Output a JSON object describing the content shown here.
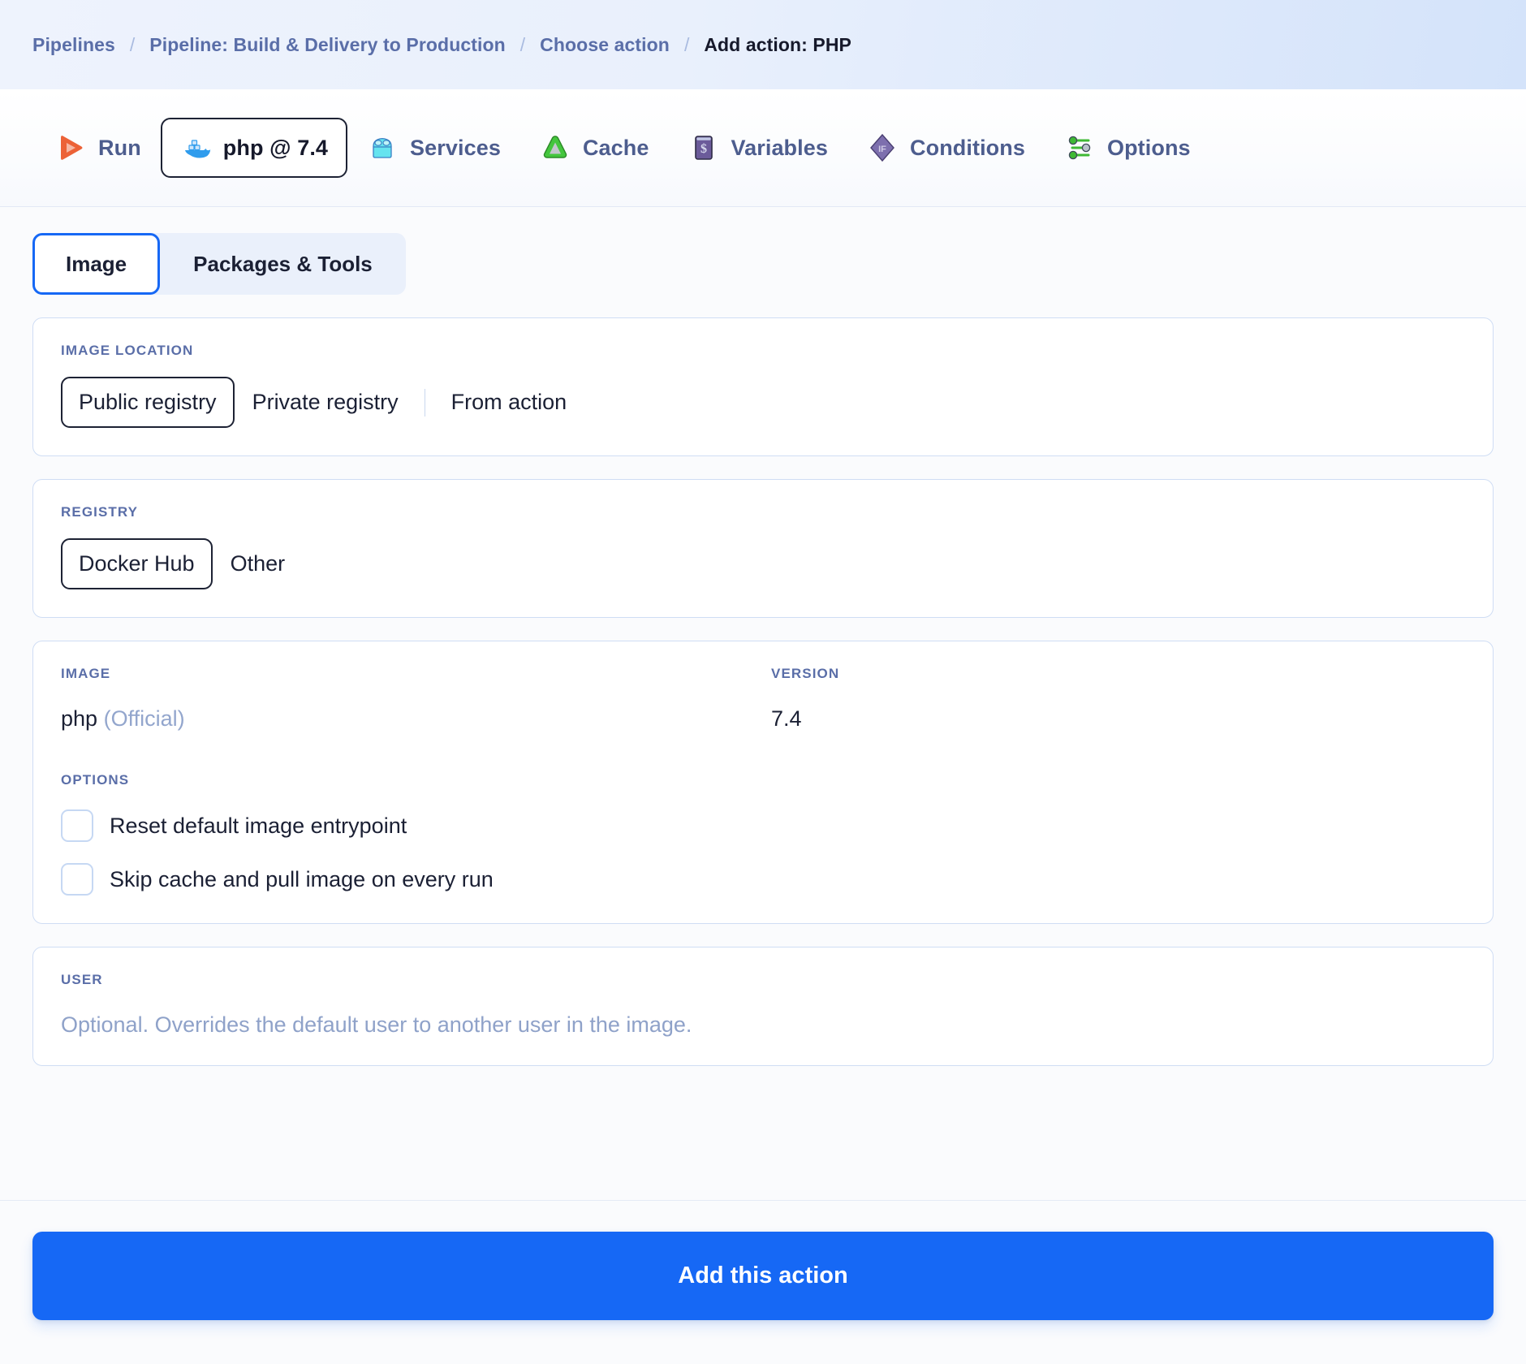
{
  "breadcrumb": {
    "separator": "/",
    "items": [
      {
        "label": "Pipelines",
        "current": false
      },
      {
        "label": "Pipeline: Build & Delivery to Production",
        "current": false
      },
      {
        "label": "Choose action",
        "current": false
      },
      {
        "label": "Add action: PHP",
        "current": true
      }
    ]
  },
  "action_tabs": {
    "items": [
      {
        "label": "Run",
        "icon": "play-icon",
        "selected": false
      },
      {
        "label": "php @ 7.4",
        "icon": "docker-whale-icon",
        "selected": true
      },
      {
        "label": "Services",
        "icon": "toolbox-icon",
        "selected": false
      },
      {
        "label": "Cache",
        "icon": "cache-triangle-icon",
        "selected": false
      },
      {
        "label": "Variables",
        "icon": "dollar-terminal-icon",
        "selected": false
      },
      {
        "label": "Conditions",
        "icon": "if-diamond-icon",
        "selected": false
      },
      {
        "label": "Options",
        "icon": "sliders-icon",
        "selected": false
      }
    ]
  },
  "subtabs": {
    "items": [
      {
        "label": "Image",
        "active": true
      },
      {
        "label": "Packages & Tools",
        "active": false
      }
    ]
  },
  "image_location": {
    "label": "IMAGE LOCATION",
    "options": [
      {
        "label": "Public registry",
        "selected": true
      },
      {
        "label": "Private registry",
        "selected": false
      },
      {
        "label": "From action",
        "selected": false
      }
    ]
  },
  "registry": {
    "label": "REGISTRY",
    "options": [
      {
        "label": "Docker Hub",
        "selected": true
      },
      {
        "label": "Other",
        "selected": false
      }
    ]
  },
  "image_card": {
    "image_label": "IMAGE",
    "version_label": "VERSION",
    "image_name": "php",
    "image_qualifier": "(Official)",
    "version_value": "7.4",
    "options_label": "OPTIONS",
    "checkboxes": [
      {
        "label": "Reset default image entrypoint",
        "checked": false
      },
      {
        "label": "Skip cache and pull image on every run",
        "checked": false
      }
    ]
  },
  "user_card": {
    "label": "USER",
    "placeholder": "Optional. Overrides the default user to another user in the image.",
    "value": ""
  },
  "footer": {
    "submit_label": "Add this action"
  },
  "colors": {
    "accent_blue": "#1668f5",
    "breadcrumb_text": "#5a6ea8",
    "card_border": "#cfddf4",
    "selected_outline": "#1d2234",
    "run_orange": "#ec6237",
    "docker_blue": "#2f9ced",
    "services_cyan": "#66e4ef",
    "cache_green": "#44c63d",
    "variables_purple": "#6b5b9a",
    "options_green": "#3fb934"
  }
}
